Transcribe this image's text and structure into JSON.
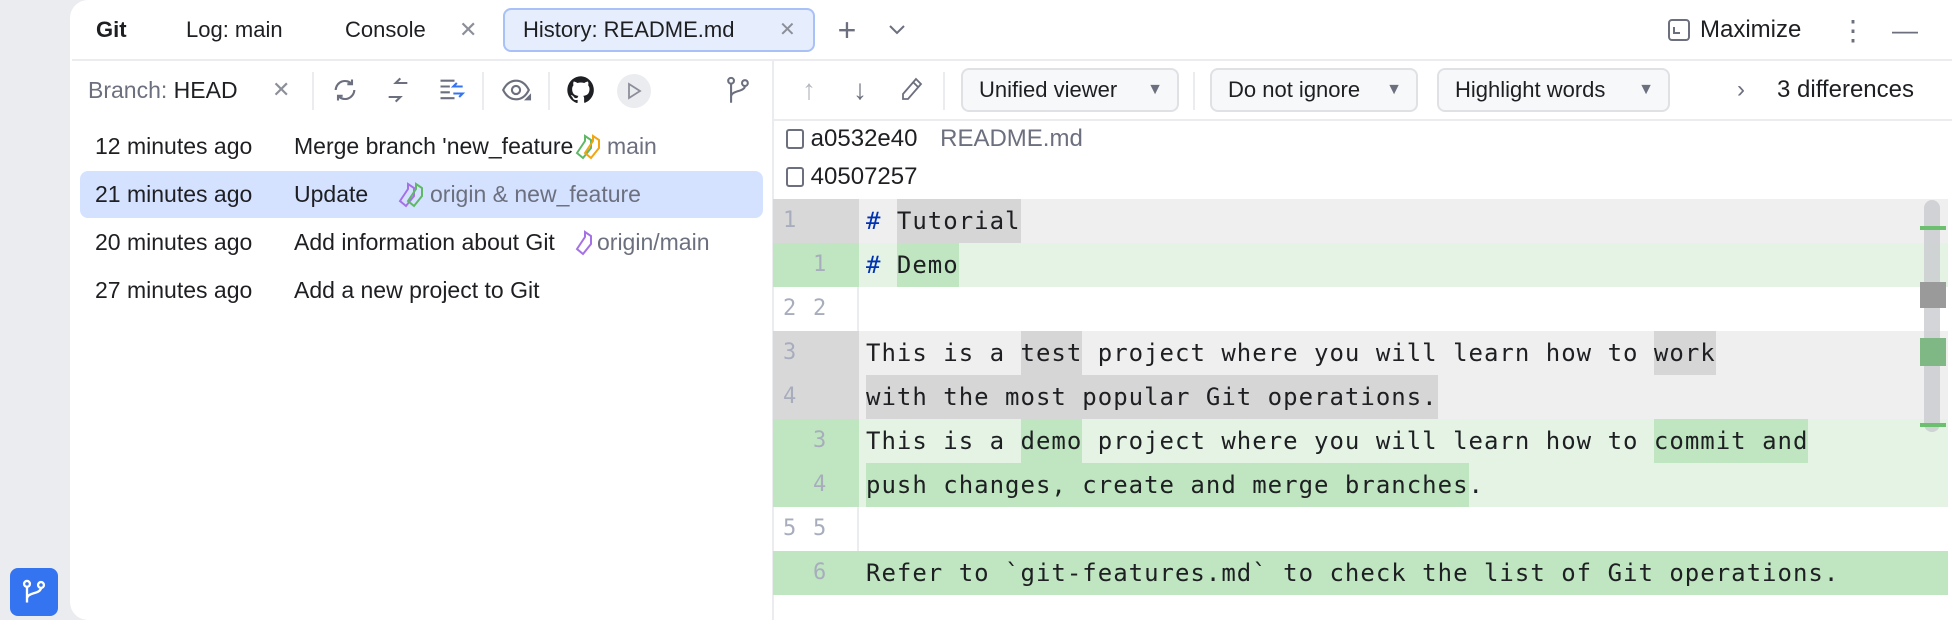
{
  "tabs": {
    "git": "Git",
    "log": "Log: main",
    "console": "Console",
    "history": "History: README.md",
    "maximize": "Maximize"
  },
  "left_toolbar": {
    "branch_label": "Branch:",
    "branch_value": "HEAD"
  },
  "commits": [
    {
      "time": "12 minutes ago",
      "message": "Merge branch 'new_feature'",
      "refs": "main",
      "tag_colors": [
        "#5fb865",
        "#f2a50f"
      ]
    },
    {
      "time": "21 minutes ago",
      "message": "Update",
      "refs": "origin & new_feature",
      "tag_colors": [
        "#a571e6",
        "#5fb865"
      ],
      "selected": true
    },
    {
      "time": "20 minutes ago",
      "message": "Add information about Git",
      "refs": "origin/main",
      "tag_colors": [
        "#a571e6"
      ]
    },
    {
      "time": "27 minutes ago",
      "message": "Add a new project to Git",
      "refs": ""
    }
  ],
  "diff_toolbar": {
    "viewer": "Unified viewer",
    "ignore": "Do not ignore",
    "highlight": "Highlight words",
    "differences": "3 differences"
  },
  "diff_header": {
    "old_rev": "a0532e40",
    "file": "README.md",
    "new_rev": "40507257"
  },
  "diff_lines": [
    {
      "type": "del",
      "old": "1",
      "new": "",
      "segs": [
        [
          "# ",
          "hash"
        ],
        [
          "Tutorial",
          "hl"
        ]
      ]
    },
    {
      "type": "ins",
      "old": "",
      "new": "1",
      "segs": [
        [
          "# ",
          "hash"
        ],
        [
          "Demo",
          "hl"
        ]
      ]
    },
    {
      "type": "eq",
      "old": "2",
      "new": "2",
      "segs": []
    },
    {
      "type": "del",
      "old": "3",
      "new": "",
      "segs": [
        [
          "This is a ",
          ""
        ],
        [
          "test",
          "hl"
        ],
        [
          " project where you will learn how to ",
          ""
        ],
        [
          "work",
          "hl"
        ]
      ]
    },
    {
      "type": "del",
      "old": "4",
      "new": "",
      "segs": [
        [
          "with the most popular Git operations.",
          "hl"
        ]
      ]
    },
    {
      "type": "ins",
      "old": "",
      "new": "3",
      "segs": [
        [
          "This is a ",
          ""
        ],
        [
          "demo",
          "hl"
        ],
        [
          " project where you will learn how to ",
          ""
        ],
        [
          "commit and",
          "hl"
        ]
      ]
    },
    {
      "type": "ins",
      "old": "",
      "new": "4",
      "segs": [
        [
          "push changes, create and merge branches",
          "hl"
        ],
        [
          ".",
          ""
        ]
      ]
    },
    {
      "type": "eq",
      "old": "5",
      "new": "5",
      "segs": []
    },
    {
      "type": "insall",
      "old": "",
      "new": "6",
      "segs": [
        [
          "Refer to `git-features.md` to check the list of Git operations.",
          ""
        ]
      ]
    }
  ],
  "colors": {
    "accent": "#3574f0",
    "selection": "#d4e2ff",
    "inserted": "#bfe6c0",
    "deleted": "#d6d6d6"
  }
}
